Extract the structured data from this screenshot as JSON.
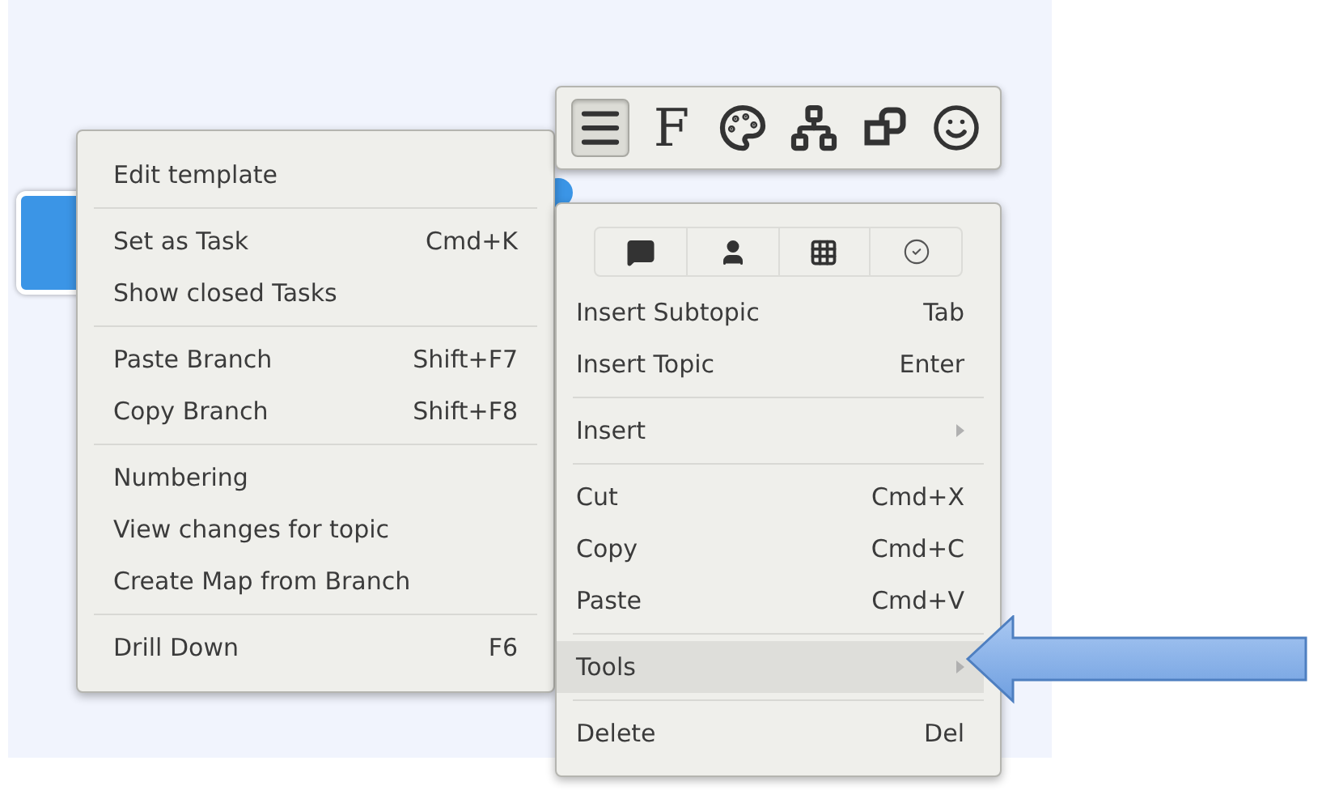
{
  "toolbar": {
    "buttons": [
      {
        "kind": "menu",
        "selected": true
      },
      {
        "kind": "font",
        "label": "F",
        "selected": false
      },
      {
        "kind": "palette",
        "selected": false
      },
      {
        "kind": "structure",
        "selected": false
      },
      {
        "kind": "shapes",
        "selected": false
      },
      {
        "kind": "smiley",
        "selected": false
      }
    ]
  },
  "context_menu": {
    "groups": [
      [
        {
          "label": "Edit template"
        }
      ],
      [
        {
          "label": "Set as Task",
          "shortcut": "Cmd+K"
        },
        {
          "label": "Show closed Tasks"
        }
      ],
      [
        {
          "label": "Paste Branch",
          "shortcut": "Shift+F7"
        },
        {
          "label": "Copy Branch",
          "shortcut": "Shift+F8"
        }
      ],
      [
        {
          "label": "Numbering"
        },
        {
          "label": "View changes for topic"
        },
        {
          "label": "Create Map from Branch"
        }
      ],
      [
        {
          "label": "Drill Down",
          "shortcut": "F6"
        }
      ]
    ]
  },
  "topic_menu": {
    "tabs": [
      {
        "kind": "comment"
      },
      {
        "kind": "person"
      },
      {
        "kind": "grid"
      },
      {
        "kind": "check"
      }
    ],
    "groups": [
      [
        {
          "label": "Insert Subtopic",
          "shortcut": "Tab",
          "submenu": false,
          "selected": false
        },
        {
          "label": "Insert Topic",
          "shortcut": "Enter",
          "submenu": false,
          "selected": false
        }
      ],
      [
        {
          "label": "Insert",
          "submenu": true,
          "selected": false
        }
      ],
      [
        {
          "label": "Cut",
          "shortcut": "Cmd+X",
          "submenu": false,
          "selected": false
        },
        {
          "label": "Copy",
          "shortcut": "Cmd+C",
          "submenu": false,
          "selected": false
        },
        {
          "label": "Paste",
          "shortcut": "Cmd+V",
          "submenu": false,
          "selected": false
        }
      ],
      [
        {
          "label": "Tools",
          "submenu": true,
          "selected": true
        }
      ],
      [
        {
          "label": "Delete",
          "shortcut": "Del",
          "submenu": false,
          "selected": false
        }
      ]
    ]
  }
}
